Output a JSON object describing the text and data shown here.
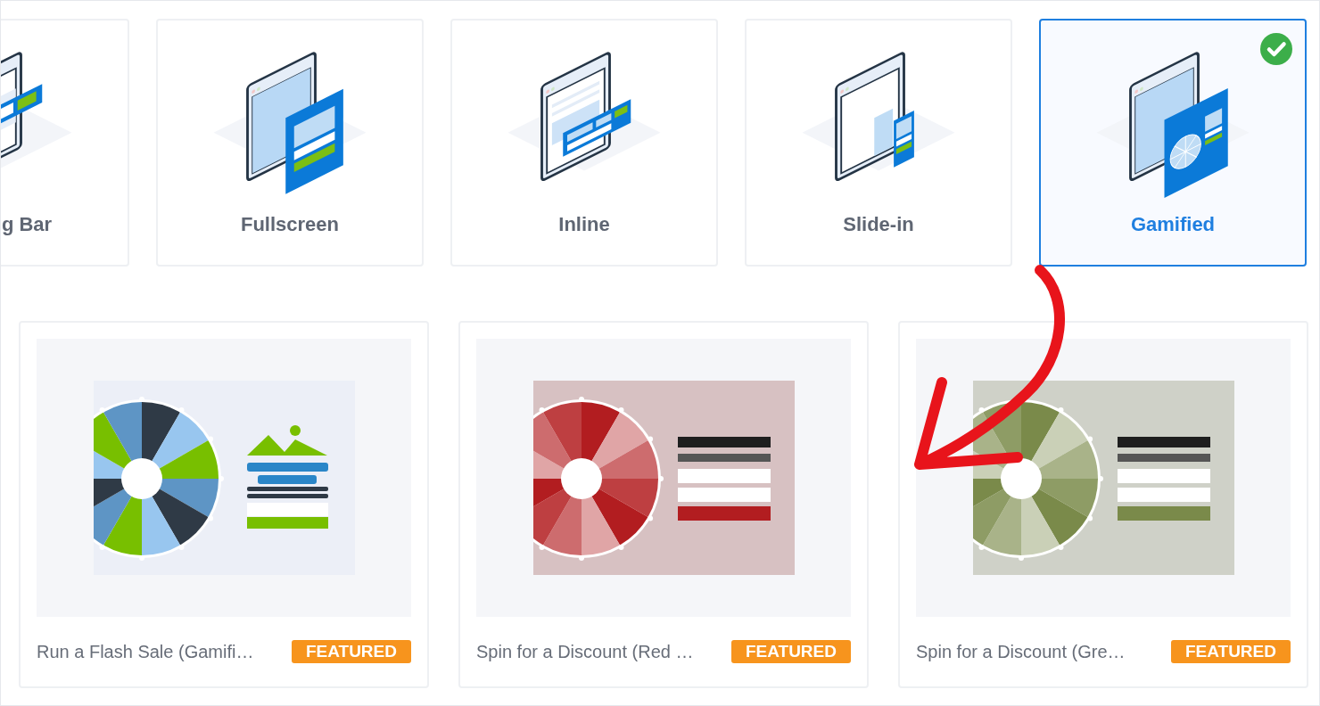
{
  "campaign_types": [
    {
      "label": "g Bar",
      "kind": "bar",
      "selected": false
    },
    {
      "label": "Fullscreen",
      "kind": "fullscreen",
      "selected": false
    },
    {
      "label": "Inline",
      "kind": "inline",
      "selected": false
    },
    {
      "label": "Slide-in",
      "kind": "slide-in",
      "selected": false
    },
    {
      "label": "Gamified",
      "kind": "gamified",
      "selected": true
    }
  ],
  "templates": [
    {
      "title": "Run a Flash Sale (Gamifi…",
      "badge": "FEATURED",
      "kind": "image-form",
      "color": "#2f3a46"
    },
    {
      "title": "Spin for a Discount (Red …",
      "badge": "FEATURED",
      "kind": "bar-form",
      "color": "#b21d20"
    },
    {
      "title": "Spin for a Discount (Gre…",
      "badge": "FEATURED",
      "kind": "bar-form",
      "color": "#7a8a4a"
    }
  ]
}
